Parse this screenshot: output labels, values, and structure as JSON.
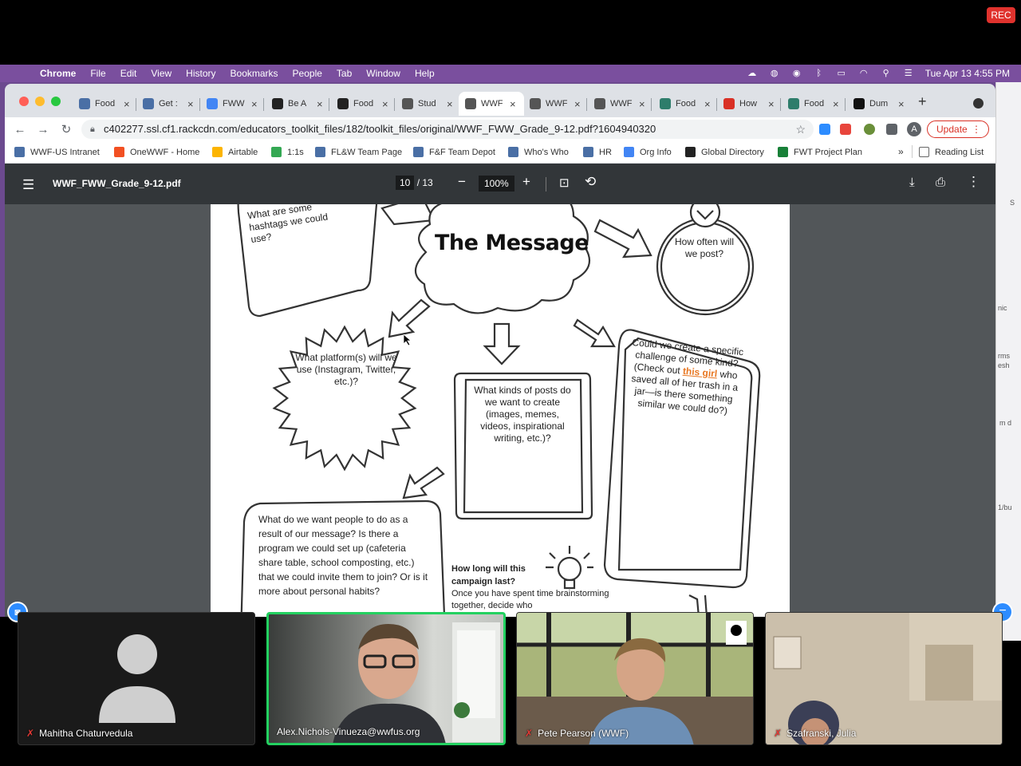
{
  "zoom": {
    "rec_label": "REC"
  },
  "menubar": {
    "app": "Chrome",
    "items": [
      "File",
      "Edit",
      "View",
      "History",
      "Bookmarks",
      "People",
      "Tab",
      "Window",
      "Help"
    ],
    "clock": "Tue Apr 13  4:55 PM"
  },
  "tabs": [
    {
      "label": "Food",
      "icon": "wwf-globe-icon",
      "color": "#4a6fa5"
    },
    {
      "label": "Get :",
      "icon": "wwf-globe-icon",
      "color": "#4a6fa5"
    },
    {
      "label": "FWW",
      "icon": "google-docs-icon",
      "color": "#4285f4"
    },
    {
      "label": "Be A",
      "icon": "panda-icon",
      "color": "#222222"
    },
    {
      "label": "Food",
      "icon": "panda-icon",
      "color": "#222222"
    },
    {
      "label": "Stud",
      "icon": "globe-icon",
      "color": "#555555"
    },
    {
      "label": "WWF",
      "icon": "globe-icon",
      "color": "#555555",
      "active": true
    },
    {
      "label": "WWF",
      "icon": "globe-icon",
      "color": "#555555"
    },
    {
      "label": "WWF",
      "icon": "globe-icon",
      "color": "#555555"
    },
    {
      "label": "Food",
      "icon": "image-icon",
      "color": "#2e7d6b"
    },
    {
      "label": "How",
      "icon": "b-icon",
      "color": "#d93025"
    },
    {
      "label": "Food",
      "icon": "image-icon",
      "color": "#2e7d6b"
    },
    {
      "label": "Dum",
      "icon": "nyt-icon",
      "color": "#111111"
    }
  ],
  "address": {
    "url": "c402277.ssl.cf1.rackcdn.com/educators_toolkit_files/182/toolkit_files/original/WWF_FWW_Grade_9-12.pdf?1604940320",
    "update_label": "Update",
    "profile_initial": "A"
  },
  "bookmarks": [
    {
      "label": "WWF-US Intranet",
      "color": "#4a6fa5"
    },
    {
      "label": "OneWWF - Home",
      "color": "#f25022"
    },
    {
      "label": "Airtable",
      "color": "#fcb400"
    },
    {
      "label": "1:1s",
      "color": "#34a853"
    },
    {
      "label": "FL&W Team Page",
      "color": "#4a6fa5"
    },
    {
      "label": "F&F Team Depot",
      "color": "#4a6fa5"
    },
    {
      "label": "Who's Who",
      "color": "#4a6fa5"
    },
    {
      "label": "HR",
      "color": "#4a6fa5"
    },
    {
      "label": "Org Info",
      "color": "#4285f4"
    },
    {
      "label": "Global Directory",
      "color": "#222222"
    },
    {
      "label": "FWT Project Plan",
      "color": "#188038"
    }
  ],
  "bookmarks_more": "»",
  "reading_list": "Reading List",
  "pdf": {
    "filename": "WWF_FWW_Grade_9-12.pdf",
    "page_current": "10",
    "page_total": "/ 13",
    "zoom": "100%",
    "worksheet": {
      "title": "The Message",
      "hashtags": "What are some hashtags we could use?",
      "how_often": "How often will we post?",
      "platforms": "What platform(s) will we use (Instagram, Twitter, etc.)?",
      "kinds": "What kinds of posts do we want to create (images, memes, videos, inspirational writing, etc.)?",
      "challenge_pre": "Could we create a specific challenge of some kind? (Check out",
      "challenge_link": "this girl",
      "challenge_post": "who saved all of her trash in a jar—is there something similar we could do?)",
      "action": "What do we want people to do as a result of our message? Is there a program we could set up (cafeteria share table, school composting, etc.) that we could invite them to join? Or is it more about personal habits?",
      "how_long_title": "How long will this campaign last?",
      "how_long_body": "Once you have spent time brainstorming together, decide who"
    }
  },
  "participants": [
    {
      "name": "Mahitha Chaturvedula",
      "muted": true,
      "video": false
    },
    {
      "name": "Alex.Nichols-Vinueza@wwfus.org",
      "muted": false,
      "video": true,
      "speaking": true
    },
    {
      "name": "Pete Pearson (WWF)",
      "muted": true,
      "video": true
    },
    {
      "name": "Szafranski, Julia",
      "muted": true,
      "video": true
    }
  ],
  "right_window_fragments": [
    "S",
    "nic",
    "rms",
    "esh",
    "m d",
    "1/bu"
  ]
}
